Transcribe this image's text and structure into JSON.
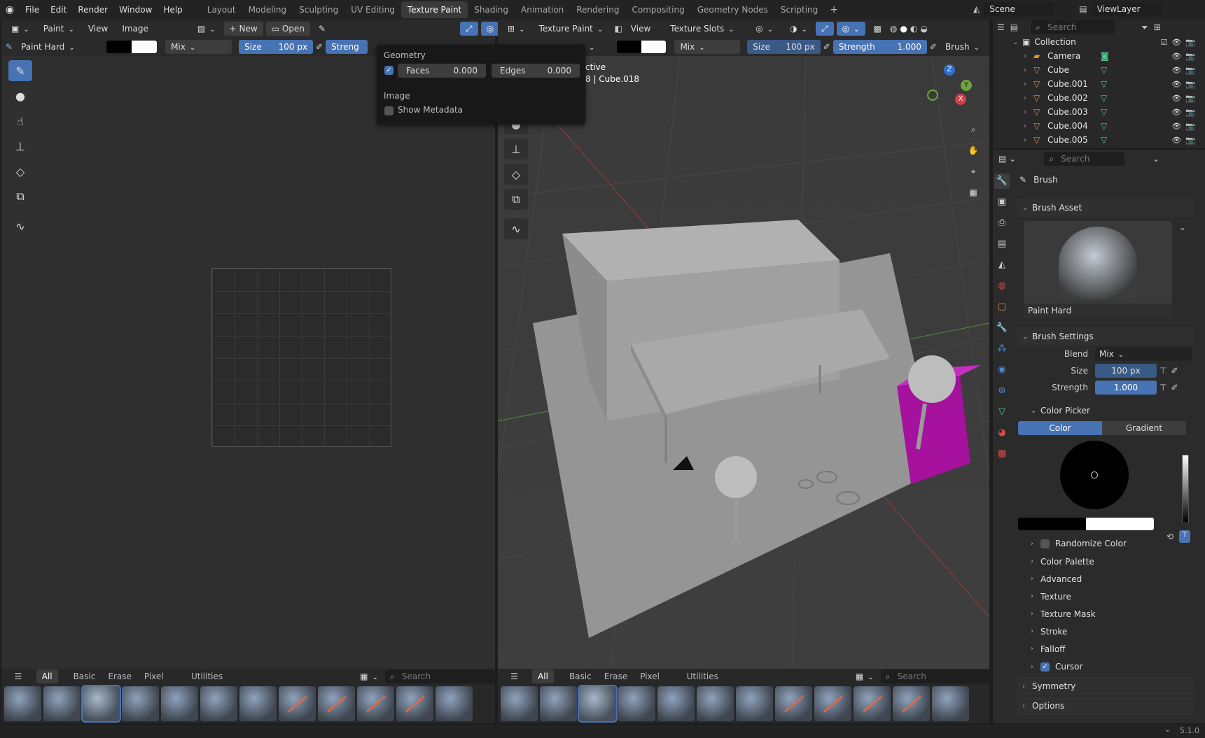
{
  "menu": {
    "file": "File",
    "edit": "Edit",
    "render": "Render",
    "window": "Window",
    "help": "Help"
  },
  "workspaces": [
    "Layout",
    "Modeling",
    "Sculpting",
    "UV Editing",
    "Texture Paint",
    "Shading",
    "Animation",
    "Rendering",
    "Compositing",
    "Geometry Nodes",
    "Scripting"
  ],
  "active_workspace": "Texture Paint",
  "scene": {
    "name": "Scene",
    "view_layer": "ViewLayer"
  },
  "image_editor": {
    "mode": "Paint",
    "view": "View",
    "image": "Image",
    "new": "New",
    "open": "Open",
    "brush": "Paint Hard",
    "blend": "Mix",
    "size_label": "Size",
    "size_value": "100 px",
    "strength_label": "Streng"
  },
  "viewport": {
    "mode": "Texture Paint",
    "view": "View",
    "slots": "Texture Slots",
    "blend": "Mix",
    "size_label": "Size",
    "size_value": "100 px",
    "strength_label": "Strength",
    "strength_value": "1.000",
    "brush": "Brush",
    "overlay_line1": "ctive",
    "overlay_line2": "8 | Cube.018"
  },
  "popup": {
    "geometry": "Geometry",
    "faces": "Faces",
    "faces_value": "0.000",
    "edges": "Edges",
    "edges_value": "0.000",
    "image": "Image",
    "show_metadata": "Show Metadata"
  },
  "shelf": {
    "tabs": [
      "All",
      "Basic",
      "Erase",
      "Pixel Art",
      "Utilities"
    ],
    "search": "Search"
  },
  "outliner": {
    "search": "Search",
    "collection": "Collection",
    "items": [
      "Camera",
      "Cube",
      "Cube.001",
      "Cube.002",
      "Cube.003",
      "Cube.004",
      "Cube.005"
    ]
  },
  "properties": {
    "search": "Search",
    "brush": "Brush",
    "brush_asset": "Brush Asset",
    "asset_name": "Paint Hard",
    "brush_settings": "Brush Settings",
    "blend_label": "Blend",
    "blend_value": "Mix",
    "size_label": "Size",
    "size_value": "100 px",
    "strength_label": "Strength",
    "strength_value": "1.000",
    "color_picker": "Color Picker",
    "color_tab": "Color",
    "gradient_tab": "Gradient",
    "randomize": "Randomize Color",
    "color_palette": "Color Palette",
    "advanced": "Advanced",
    "texture": "Texture",
    "texture_mask": "Texture Mask",
    "stroke": "Stroke",
    "falloff": "Falloff",
    "cursor": "Cursor",
    "symmetry": "Symmetry",
    "options": "Options"
  },
  "gizmo": {
    "x": "X",
    "y": "Y",
    "z": "Z"
  },
  "status": {
    "version": "5.1.0"
  },
  "colors": {
    "accent": "#4772b3",
    "magenta_cube": "#a6119e"
  }
}
